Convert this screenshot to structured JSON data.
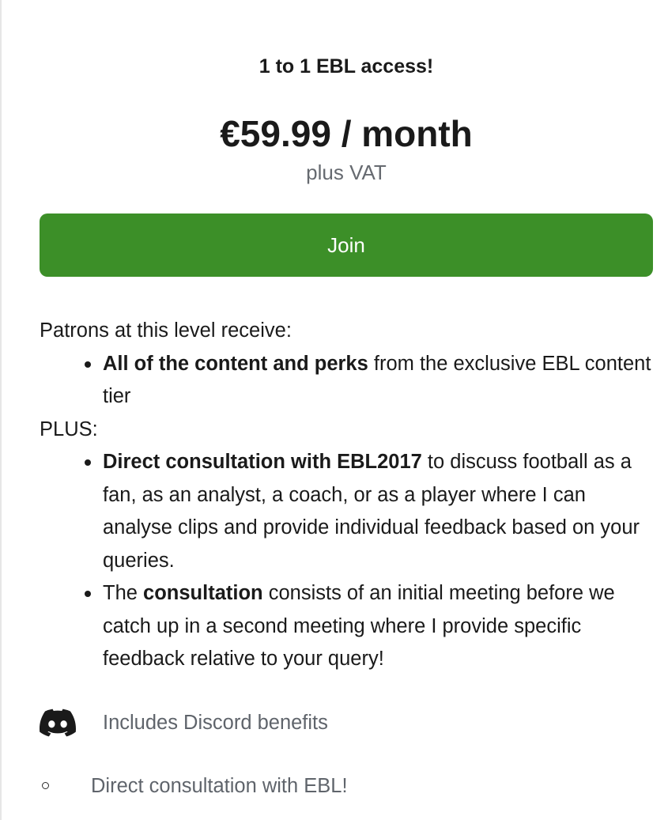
{
  "tier": {
    "title": "1 to 1 EBL access!",
    "price": "€59.99 / month",
    "price_note": "plus VAT",
    "join_label": "Join"
  },
  "description": {
    "intro": "Patrons at this level receive:",
    "list1": [
      {
        "bold": "All of the content and perks",
        "rest": " from the exclusive EBL content tier"
      }
    ],
    "plus": "PLUS:",
    "list2": [
      {
        "bold": "Direct consultation with EBL2017",
        "rest": " to discuss football as a fan, as an analyst, a coach, or as a player where I can analyse clips and provide individual feedback based on your queries."
      },
      {
        "before": "The ",
        "bold": "consultation",
        "rest": " consists of an initial meeting before we catch up in a second meeting where I provide specific feedback relative to your query!"
      }
    ]
  },
  "benefits": [
    {
      "icon": "discord-icon",
      "label": "Includes Discord benefits"
    },
    {
      "icon": "circle-bullet-icon",
      "label": "Direct consultation with EBL!"
    }
  ],
  "colors": {
    "join_button": "#3c8f28",
    "muted_text": "#5f646b",
    "text": "#1a1a1a"
  }
}
